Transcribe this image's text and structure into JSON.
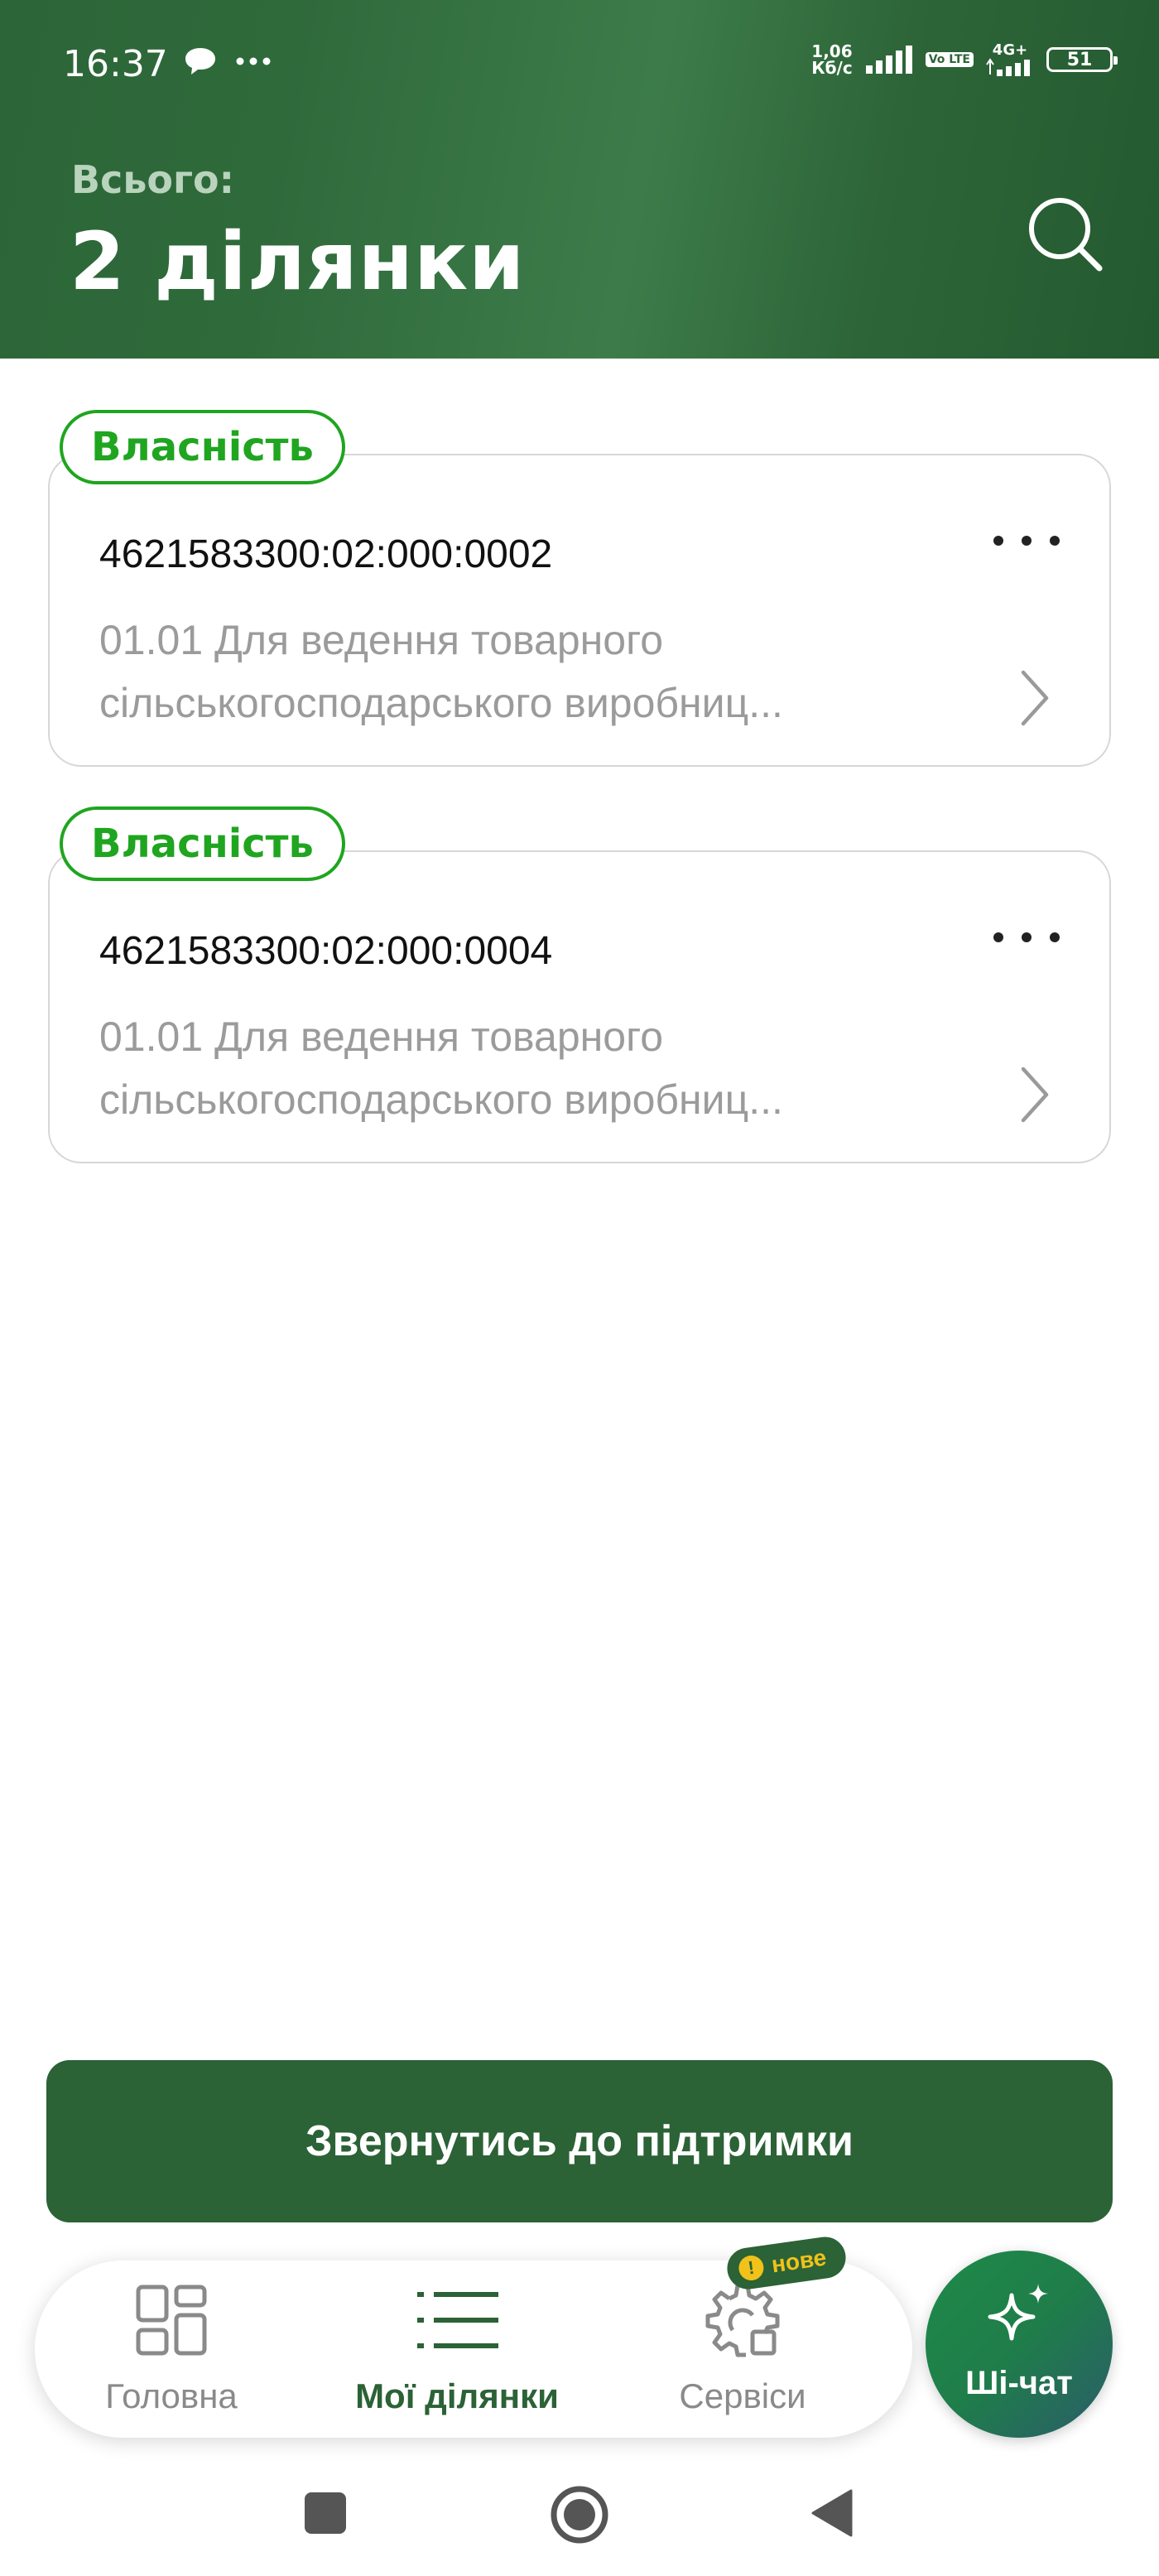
{
  "status_bar": {
    "time": "16:37",
    "net_speed_value": "1,06",
    "net_speed_unit": "Кб/с",
    "lte_label": "Vo LTE",
    "network_type": "4G+",
    "battery": "51"
  },
  "header": {
    "total_label": "Всього:",
    "total_value": "2 ділянки"
  },
  "plots": [
    {
      "badge": "Власність",
      "cadastral_number": "4621583300:02:000:0002",
      "purpose_line1": "01.01 Для ведення товарного",
      "purpose_line2": "сільськогосподарського виробниц..."
    },
    {
      "badge": "Власність",
      "cadastral_number": "4621583300:02:000:0004",
      "purpose_line1": "01.01 Для ведення товарного",
      "purpose_line2": "сільськогосподарського виробниц..."
    }
  ],
  "support_button": "Звернутись до підтримки",
  "bottom_nav": {
    "items": [
      {
        "label": "Головна",
        "icon": "dashboard-icon"
      },
      {
        "label": "Мої ділянки",
        "icon": "list-icon",
        "active": true
      },
      {
        "label": "Сервіси",
        "icon": "gear-icon"
      }
    ],
    "new_badge": "нове",
    "ai_chat_label": "Ші-чат"
  },
  "colors": {
    "brand_green": "#2b6236",
    "badge_green": "#1fa51f",
    "new_badge_yellow": "#f0c21a"
  }
}
